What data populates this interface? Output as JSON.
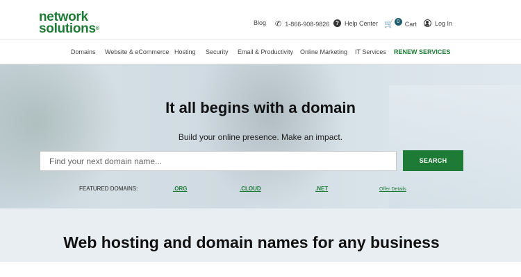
{
  "header": {
    "logo_line1": "network",
    "logo_line2": "solutions",
    "logo_reg": "®",
    "blog": "Blog",
    "phone": "1-866-908-9826",
    "help": "Help Center",
    "cart_count": "0",
    "cart": "Cart",
    "login": "Log In"
  },
  "nav": {
    "items": [
      "Domains",
      "Website & eCommerce",
      "Hosting",
      "Security",
      "Email & Productivity",
      "Online Marketing",
      "IT Services",
      "RENEW SERVICES"
    ]
  },
  "hero": {
    "title": "It all begins with a domain",
    "subtitle": "Build your online presence. Make an impact.",
    "search_placeholder": "Find your next domain name...",
    "search_button": "SEARCH",
    "featured_label": "FEATURED DOMAINS:",
    "featured": [
      ".ORG",
      ".CLOUD",
      ".NET"
    ],
    "offer_details": "Offer Details"
  },
  "section": {
    "title": "Web hosting and domain names for any business"
  },
  "colors": {
    "brand_green": "#1e7b36",
    "cart_badge": "#1e5d6e"
  }
}
